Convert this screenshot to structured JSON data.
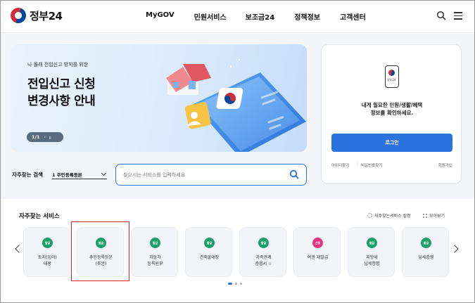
{
  "header": {
    "logo_text": "정부24",
    "nav": [
      "MyGOV",
      "민원서비스",
      "보조금24",
      "정책정보",
      "고객센터"
    ],
    "search_icon": "search-icon",
    "menu_icon": "hamburger-menu-icon"
  },
  "banner": {
    "subtitle": "나 몰래 전입신고 방지를 위한",
    "title_line1": "전입신고 신청",
    "title_line2": "변경사항 안내",
    "pager_text": "1/1",
    "pager_prev": "‹",
    "pager_pause": "॥"
  },
  "login_card": {
    "app_label": "정부24",
    "message_line1": "내게 필요한 민원/생활/혜택",
    "message_line2": "정보를 확인하세요.",
    "login_button": "로그인",
    "find_id": "아이디찾기",
    "separator": "|",
    "find_password": "비밀번호찾기",
    "signup": "회원가입"
  },
  "quick_search": {
    "label": "자주찾는 검색",
    "selected": "1 주민등록등본",
    "placeholder": "찾으시는 서비스를 입력하세요"
  },
  "services": {
    "title": "자주찾는 서비스",
    "settings_label": "자주찾는서비스 설정",
    "more_label": "모아보기",
    "items": [
      {
        "badge": "발급",
        "line1": "토지(임야)",
        "line2": "대장"
      },
      {
        "badge": "발급",
        "line1": "주민등록등본",
        "line2": "(초본)"
      },
      {
        "badge": "발급",
        "line1": "자동차",
        "line2": "등록원부"
      },
      {
        "badge": "발급",
        "line1": "건축물대장",
        "line2": ""
      },
      {
        "badge": "발급",
        "line1": "가족관계",
        "line2": "증명서 ☆"
      },
      {
        "badge": "신청",
        "line1": "여권 재발급",
        "line2": ""
      },
      {
        "badge": "발급",
        "line1": "지방세",
        "line2": "납세증명"
      },
      {
        "badge": "발급",
        "line1": "납세증명",
        "line2": ""
      }
    ]
  },
  "colors": {
    "accent": "#2d73e0",
    "badge_green": "#1e9e6a",
    "badge_pink": "#e8337f",
    "highlight": "#e02020"
  }
}
